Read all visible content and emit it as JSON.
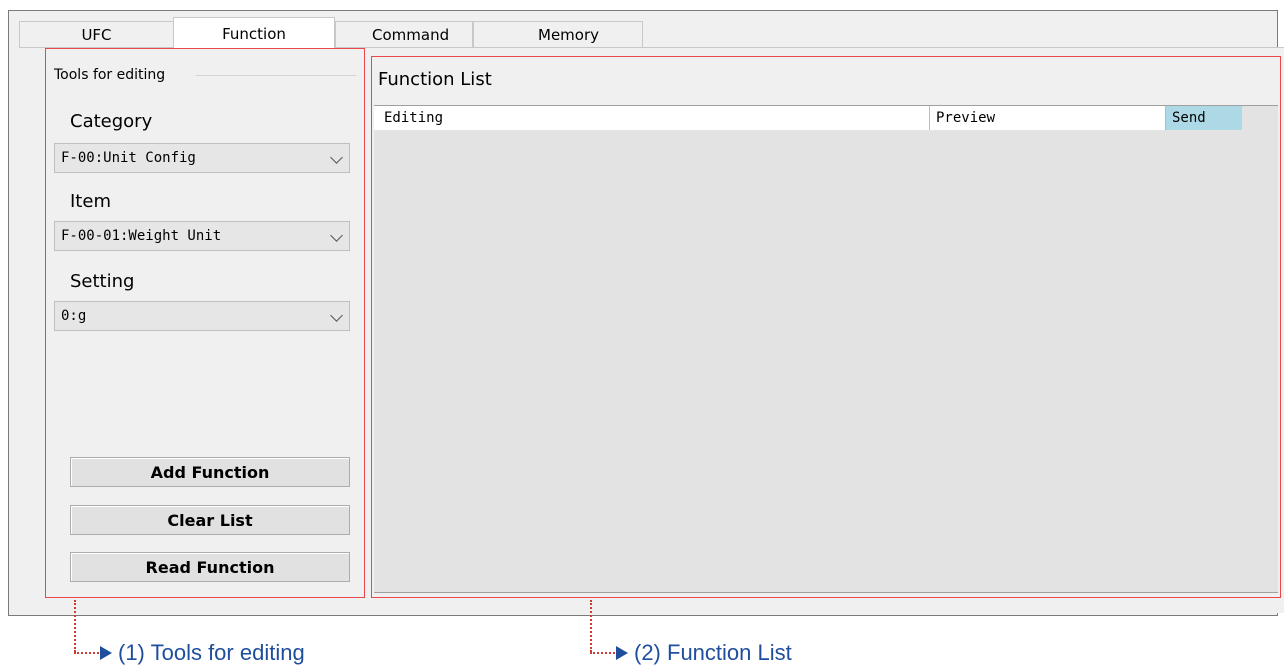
{
  "tabs": [
    {
      "label": "UFC"
    },
    {
      "label": "Function"
    },
    {
      "label": "Command"
    },
    {
      "label": "Memory"
    }
  ],
  "tools": {
    "legend": "Tools for editing",
    "category": {
      "label": "Category",
      "value": "F-00:Unit Config"
    },
    "item": {
      "label": "Item",
      "value": "F-00-01:Weight Unit"
    },
    "setting": {
      "label": "Setting",
      "value": "0:g"
    },
    "buttons": {
      "add": "Add Function",
      "clear": "Clear List",
      "read": "Read Function"
    }
  },
  "function_list": {
    "title": "Function List",
    "columns": [
      "Editing",
      "Preview",
      "Send"
    ]
  },
  "annotations": {
    "tools": "(1) Tools for editing",
    "list": "(2) Function List"
  },
  "colors": {
    "highlight_box": "#e8484a",
    "annotation_text": "#1f4e9c",
    "annotation_dots": "#d03a2e",
    "send_column": "#add8e6"
  }
}
